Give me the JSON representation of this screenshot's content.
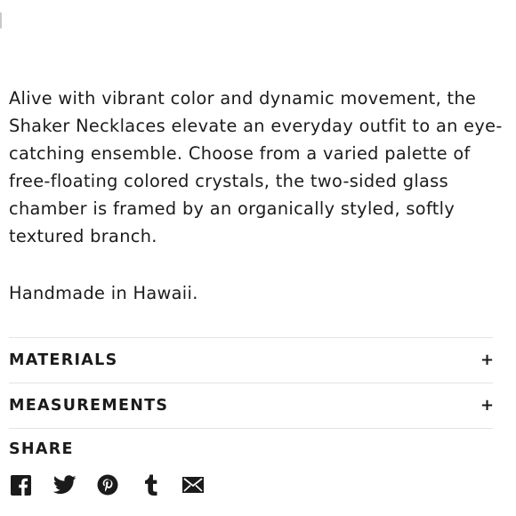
{
  "product": {
    "description": "Alive with vibrant color and dynamic movement, the Shaker Necklaces elevate an everyday outfit to an eye-catching ensemble. Choose from a varied palette of free-floating colored crystals, the two-sided glass chamber is framed by an organically styled, softly textured branch.",
    "origin": "Handmade in Hawaii."
  },
  "accordion": [
    {
      "label": "MATERIALS",
      "toggle": "+"
    },
    {
      "label": "MEASUREMENTS",
      "toggle": "+"
    }
  ],
  "share": {
    "heading": "SHARE",
    "icons": [
      "facebook-icon",
      "twitter-icon",
      "pinterest-icon",
      "tumblr-icon",
      "email-icon"
    ]
  }
}
